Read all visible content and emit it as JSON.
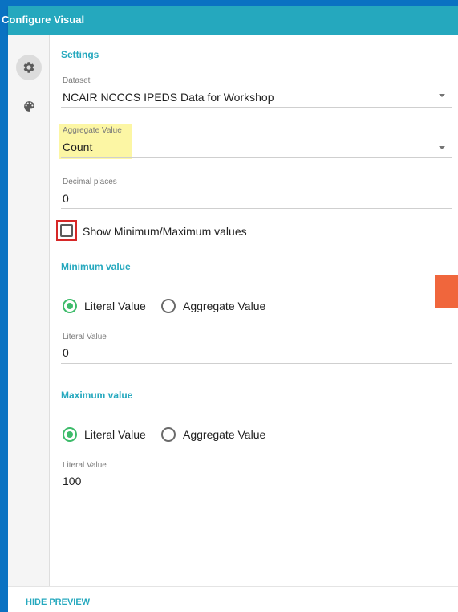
{
  "header": {
    "title": "Configure Visual"
  },
  "rail": {
    "items": [
      {
        "icon": "gear-icon",
        "active": true
      },
      {
        "icon": "palette-icon",
        "active": false
      }
    ]
  },
  "settings": {
    "section_title": "Settings",
    "dataset": {
      "label": "Dataset",
      "value": "NCAIR NCCCS IPEDS Data for Workshop"
    },
    "aggregate": {
      "label": "Aggregate Value",
      "value": "Count"
    },
    "decimal_places": {
      "label": "Decimal places",
      "value": "0"
    },
    "show_minmax": {
      "label": "Show Minimum/Maximum values",
      "checked": false
    }
  },
  "minimum": {
    "section_title": "Minimum value",
    "options": [
      "Literal Value",
      "Aggregate Value"
    ],
    "selected": "Literal Value",
    "literal": {
      "label": "Literal Value",
      "value": "0"
    }
  },
  "maximum": {
    "section_title": "Maximum value",
    "options": [
      "Literal Value",
      "Aggregate Value"
    ],
    "selected": "Literal Value",
    "literal": {
      "label": "Literal Value",
      "value": "100"
    }
  },
  "footer": {
    "hide_preview_label": "HIDE PREVIEW"
  },
  "colors": {
    "header": "#25a8be",
    "accent": "#25a8be",
    "frame": "#0a72c2",
    "radio_selected": "#3dbb6a",
    "highlight": "#fcf6a4",
    "annotation_box": "#d62828",
    "orange_block": "#f0663c"
  }
}
